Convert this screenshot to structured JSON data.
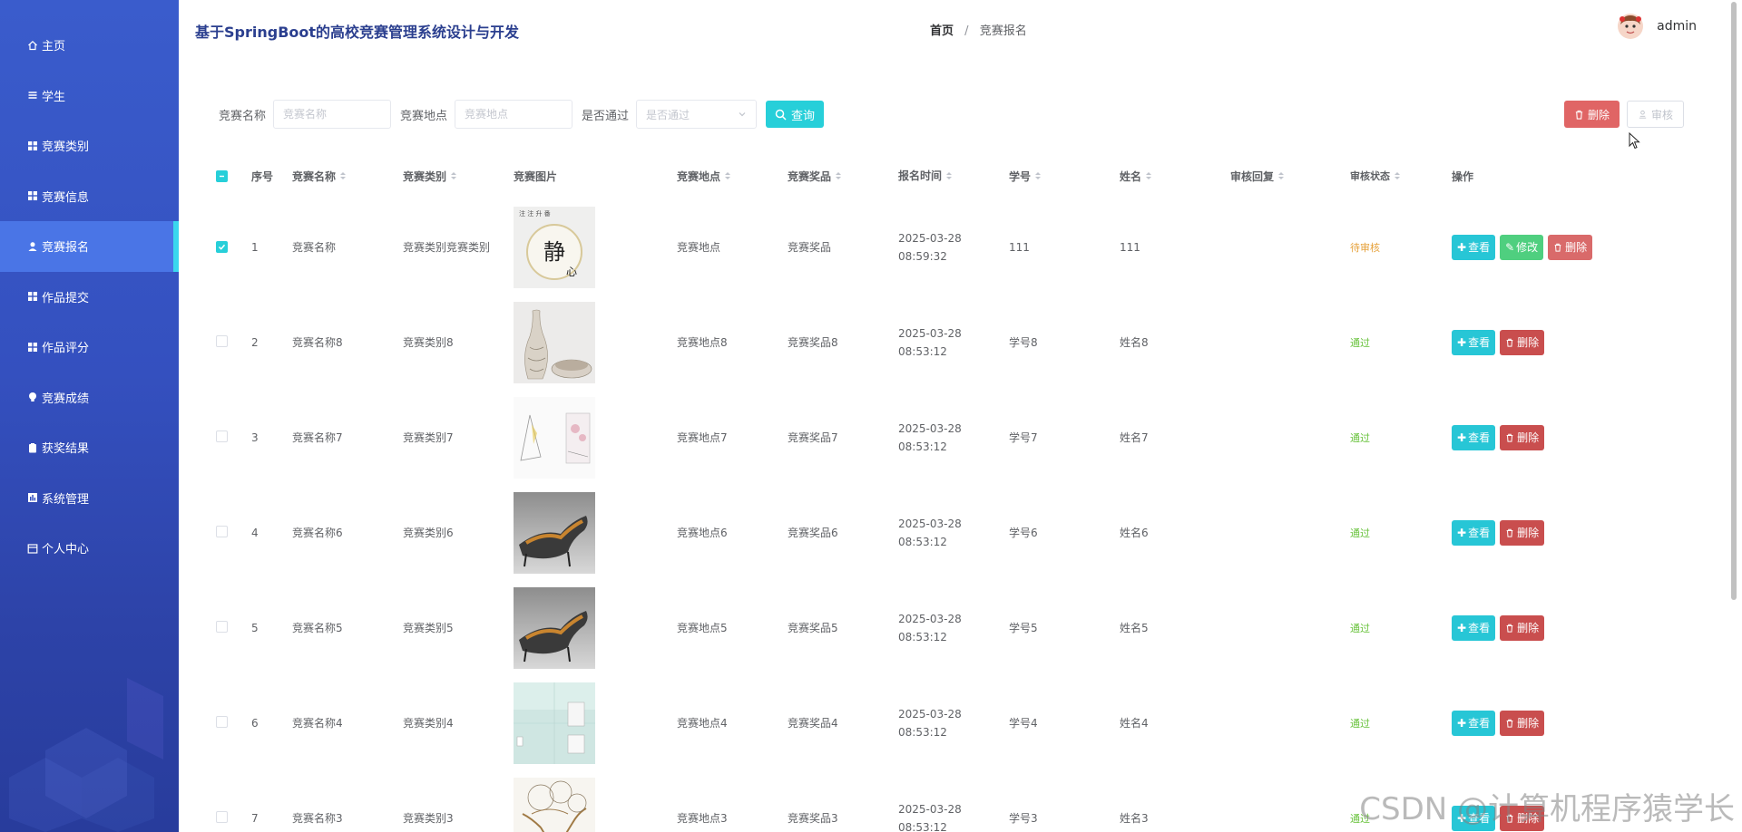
{
  "sidebar": {
    "items": [
      {
        "label": "主页",
        "icon": "home-icon",
        "active": false
      },
      {
        "label": "学生",
        "icon": "list-icon",
        "active": false
      },
      {
        "label": "竞赛类别",
        "icon": "grid-icon",
        "active": false
      },
      {
        "label": "竞赛信息",
        "icon": "grid-icon",
        "active": false
      },
      {
        "label": "竞赛报名",
        "icon": "user-icon",
        "active": true
      },
      {
        "label": "作品提交",
        "icon": "grid-icon",
        "active": false
      },
      {
        "label": "作品评分",
        "icon": "grid-icon",
        "active": false
      },
      {
        "label": "竞赛成绩",
        "icon": "bulb-icon",
        "active": false
      },
      {
        "label": "获奖结果",
        "icon": "clipboard-icon",
        "active": false
      },
      {
        "label": "系统管理",
        "icon": "chart-icon",
        "active": false
      },
      {
        "label": "个人中心",
        "icon": "calendar-icon",
        "active": false
      }
    ]
  },
  "header": {
    "title": "基于SpringBoot的高校竞赛管理系统设计与开发",
    "breadcrumb_home": "首页",
    "breadcrumb_sep": "/",
    "breadcrumb_current": "竞赛报名",
    "username": "admin"
  },
  "search": {
    "name_label": "竞赛名称",
    "name_placeholder": "竞赛名称",
    "location_label": "竞赛地点",
    "location_placeholder": "竞赛地点",
    "passed_label": "是否通过",
    "passed_placeholder": "是否通过",
    "query_button": "查询"
  },
  "toolbar": {
    "delete_button": "删除",
    "audit_button": "审核"
  },
  "table": {
    "columns": {
      "index": "序号",
      "name": "竞赛名称",
      "category": "竞赛类别",
      "image": "竞赛图片",
      "location": "竞赛地点",
      "prize": "竞赛奖品",
      "time": "报名时间",
      "student_no": "学号",
      "student_name": "姓名",
      "reply": "审核回复",
      "status": "审核状态",
      "ops": "操作"
    },
    "op_labels": {
      "view": "查看",
      "edit": "修改",
      "delete": "删除"
    },
    "rows": [
      {
        "index": "1",
        "name": "竞赛名称",
        "category": "竞赛类别竞赛类别",
        "image": "calligraphy",
        "location": "竞赛地点",
        "prize": "竞赛奖品",
        "time": "2025-03-28 08:59:32",
        "student_no": "111",
        "student_name": "111",
        "reply": "",
        "status": "待审核",
        "status_color": "#e6a23c",
        "checked": true,
        "editable": true
      },
      {
        "index": "2",
        "name": "竞赛名称8",
        "category": "竞赛类别8",
        "image": "vase",
        "location": "竞赛地点8",
        "prize": "竞赛奖品8",
        "time": "2025-03-28 08:53:12",
        "student_no": "学号8",
        "student_name": "姓名8",
        "reply": "",
        "status": "通过",
        "status_color": "#67c23a",
        "checked": false,
        "editable": false
      },
      {
        "index": "3",
        "name": "竞赛名称7",
        "category": "竞赛类别7",
        "image": "sketch",
        "location": "竞赛地点7",
        "prize": "竞赛奖品7",
        "time": "2025-03-28 08:53:12",
        "student_no": "学号7",
        "student_name": "姓名7",
        "reply": "",
        "status": "通过",
        "status_color": "#67c23a",
        "checked": false,
        "editable": false
      },
      {
        "index": "4",
        "name": "竞赛名称6",
        "category": "竞赛类别6",
        "image": "chair",
        "location": "竞赛地点6",
        "prize": "竞赛奖品6",
        "time": "2025-03-28 08:53:12",
        "student_no": "学号6",
        "student_name": "姓名6",
        "reply": "",
        "status": "通过",
        "status_color": "#67c23a",
        "checked": false,
        "editable": false
      },
      {
        "index": "5",
        "name": "竞赛名称5",
        "category": "竞赛类别5",
        "image": "chair",
        "location": "竞赛地点5",
        "prize": "竞赛奖品5",
        "time": "2025-03-28 08:53:12",
        "student_no": "学号5",
        "student_name": "姓名5",
        "reply": "",
        "status": "通过",
        "status_color": "#67c23a",
        "checked": false,
        "editable": false
      },
      {
        "index": "6",
        "name": "竞赛名称4",
        "category": "竞赛类别4",
        "image": "bathroom",
        "location": "竞赛地点4",
        "prize": "竞赛奖品4",
        "time": "2025-03-28 08:53:12",
        "student_no": "学号4",
        "student_name": "姓名4",
        "reply": "",
        "status": "通过",
        "status_color": "#67c23a",
        "checked": false,
        "editable": false
      },
      {
        "index": "7",
        "name": "竞赛名称3",
        "category": "竞赛类别3",
        "image": "tree",
        "location": "竞赛地点3",
        "prize": "竞赛奖品3",
        "time": "2025-03-28 08:53:12",
        "student_no": "学号3",
        "student_name": "姓名3",
        "reply": "",
        "status": "通过",
        "status_color": "#67c23a",
        "checked": false,
        "editable": false
      }
    ]
  },
  "watermark": "CSDN @计算机程序猿学长",
  "colors": {
    "accent": "#27cfd9",
    "danger": "#e06565",
    "sidebar": "#3450bf",
    "sidebar_active": "#4a75e6"
  }
}
